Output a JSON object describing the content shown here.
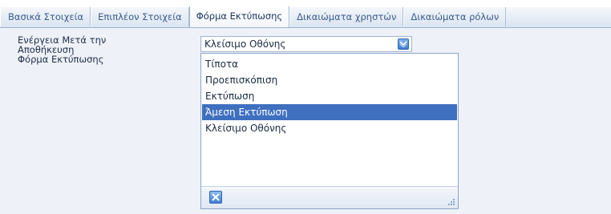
{
  "tabs": [
    {
      "label": "Βασικά Στοιχεία",
      "active": false
    },
    {
      "label": "Επιπλέον Στοιχεία",
      "active": false
    },
    {
      "label": "Φόρμα Εκτύπωσης",
      "active": true
    },
    {
      "label": "Δικαιώματα χρηστών",
      "active": false
    },
    {
      "label": "Δικαιώματα ρόλων",
      "active": false
    }
  ],
  "field": {
    "label": "Ενέργεια Μετά την\nΑποθήκευση\nΦόρμα Εκτύπωσης",
    "value": "Κλείσιμο Οθόνης"
  },
  "dropdown": {
    "options": [
      "Τίποτα",
      "Προεπισκόπιση",
      "Εκτύπωση",
      "Άμεση Εκτύπωση",
      "Κλείσιμο Οθόνης"
    ],
    "highlighted": "Άμεση Εκτύπωση"
  },
  "icons": {
    "combo_button": "chevron-down-icon",
    "close": "close-icon",
    "resize": "resize-grip-icon"
  },
  "colors": {
    "highlight": "#3f6fbf",
    "tab_text": "#3a5a8c"
  }
}
